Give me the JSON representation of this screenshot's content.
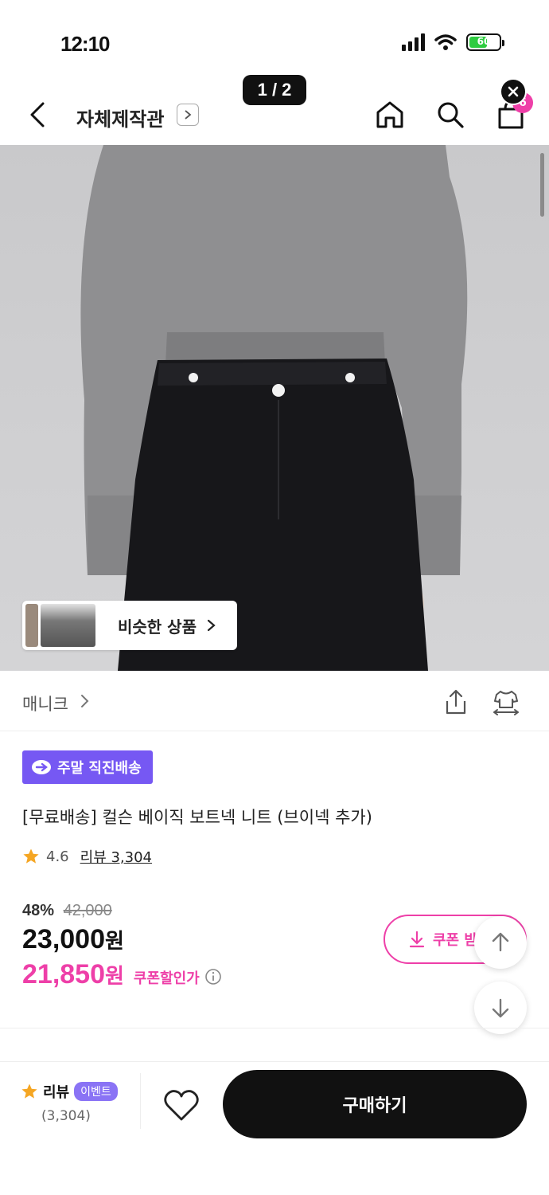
{
  "status_bar": {
    "time": "12:10",
    "battery": "60"
  },
  "page_indicator": "1 / 2",
  "header": {
    "store_name": "자체제작관",
    "bag_count": "6"
  },
  "image": {
    "similar_label": "비슷한 상품"
  },
  "brand": {
    "name": "매니크"
  },
  "product": {
    "delivery_badge": "주말 직진배송",
    "title": "[무료배송] 컬슨 베이직 보트넥 니트 (브이넥 추가)",
    "rating": "4.6",
    "review_link": "리뷰 3,304",
    "discount_pct": "48%",
    "original_price": "42,000",
    "price": "23,000",
    "price_unit": "원",
    "coupon_price": "21,850",
    "coupon_label": "쿠폰할인가",
    "coupon_button": "쿠폰 받기"
  },
  "bottom_bar": {
    "review_label": "리뷰",
    "event_badge": "이벤트",
    "review_count": "(3,304)",
    "buy_label": "구매하기"
  },
  "colors": {
    "accent_pink": "#ee3fa8",
    "accent_purple": "#7658f3"
  }
}
